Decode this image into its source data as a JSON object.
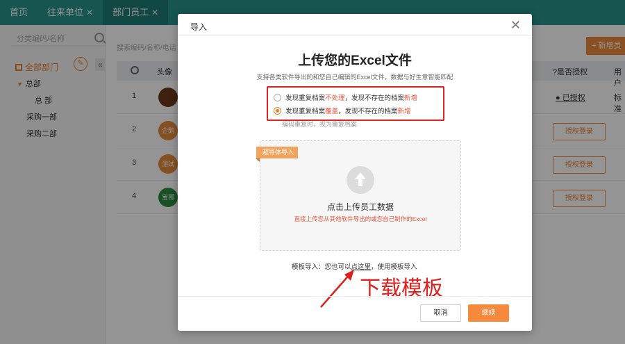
{
  "tabs": [
    {
      "label": "首页",
      "closable": false
    },
    {
      "label": "往来单位",
      "closable": true
    },
    {
      "label": "部门员工",
      "closable": true
    }
  ],
  "sidebar": {
    "search_placeholder": "分类编码/名称",
    "root_label": "全部部门",
    "items": [
      {
        "label": "总部",
        "expanded": true
      },
      {
        "label": "总 部"
      },
      {
        "label": "采购一部"
      },
      {
        "label": "采购二部"
      }
    ]
  },
  "main": {
    "search_placeholder": "搜索编码/名称/电话",
    "add_button": "+ 新增员工",
    "columns": {
      "avatar": "头像",
      "authorized": "?是否授权",
      "user": "用户"
    },
    "rows": [
      {
        "num": "1",
        "avatar_text": "",
        "avatar_color": "#6b3a1a",
        "auth_text": "● 已授权",
        "std": "标准"
      },
      {
        "num": "2",
        "avatar_text": "企鹅",
        "avatar_color": "#e58a3a",
        "auth_text": "授权登录"
      },
      {
        "num": "3",
        "avatar_text": "测试",
        "avatar_color": "#e58a3a",
        "auth_text": "授权登录"
      },
      {
        "num": "4",
        "avatar_text": "宝哥",
        "avatar_color": "#2b8a3e",
        "auth_text": "授权登录"
      }
    ]
  },
  "modal": {
    "title": "导入",
    "heading": "上传您的Excel文件",
    "subtitle": "支持各类软件导出的和您自己编辑的Excel文件，数据与好生意智能匹配",
    "option1": {
      "pre": "发现重复档案",
      "hl1": "不处理",
      "mid": "，发现不存在的档案",
      "hl2": "新增"
    },
    "option2": {
      "pre": "发现重复档案",
      "hl1": "覆盖",
      "mid": "，发现不存在的档案",
      "hl2": "新增"
    },
    "selected_option": 2,
    "hint": "编码重复时，视为重复档案",
    "ribbon": "超导体导入",
    "upload_title": "点击上传员工数据",
    "upload_desc": "直接上传您从其他软件导出的或您自己制作的Excel",
    "template_pre": "模板导入：您也可以",
    "template_link": "点这里",
    "template_post": "，使用模板导入",
    "annotation": "下载模板",
    "cancel": "取消",
    "confirm": "继续"
  },
  "colors": {
    "nav": "#29948a",
    "accent": "#ef7e2b",
    "annotation": "#e0201c"
  }
}
